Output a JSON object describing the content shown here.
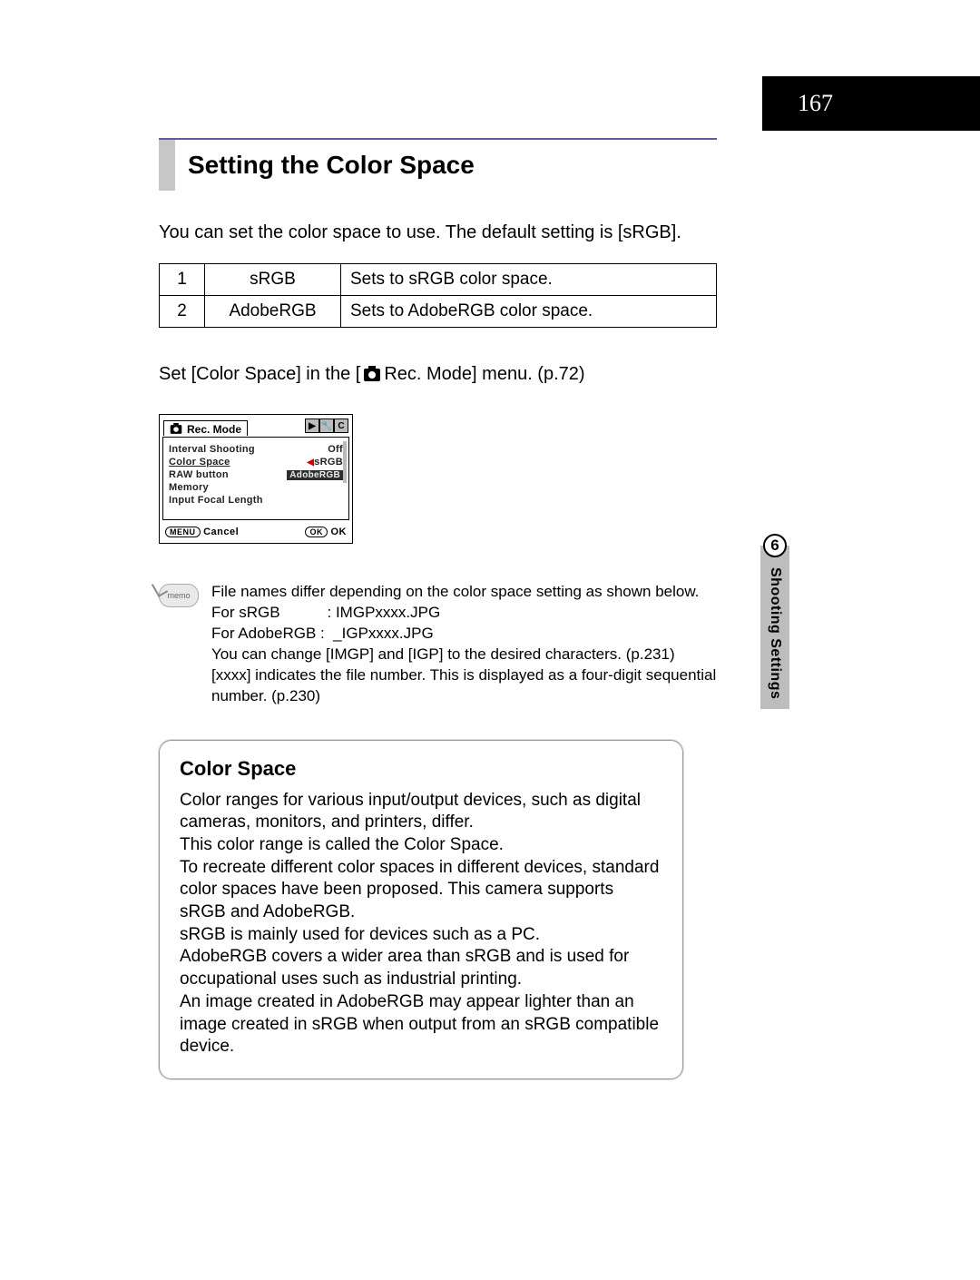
{
  "page_number": "167",
  "side": {
    "chapter_num": "6",
    "chapter_title": "Shooting Settings"
  },
  "heading": "Setting the Color Space",
  "intro": "You can set the color space to use. The default setting is [sRGB].",
  "options": [
    {
      "num": "1",
      "name": "sRGB",
      "desc": "Sets to sRGB color space."
    },
    {
      "num": "2",
      "name": "AdobeRGB",
      "desc": "Sets to AdobeRGB color space."
    }
  ],
  "set_line": {
    "pre": "Set [Color Space] in the [",
    "post": " Rec. Mode] menu. (p.72)"
  },
  "lcd": {
    "tab_label": "Rec. Mode",
    "right_icons": [
      "▶",
      "🔧",
      "C"
    ],
    "rows": [
      {
        "label": "Interval Shooting",
        "value": "Off",
        "selected": false
      },
      {
        "label": "Color Space",
        "value_srgb": "sRGB",
        "value_adobe": "AdobeRGB",
        "selected": true
      },
      {
        "label": "RAW button",
        "value": "",
        "selected": false
      },
      {
        "label": "Memory",
        "value": "",
        "selected": false
      },
      {
        "label": "Input Focal Length",
        "value": "",
        "selected": false
      }
    ],
    "foot_left_btn": "MENU",
    "foot_left": "Cancel",
    "foot_right_btn": "OK",
    "foot_right": "OK"
  },
  "memo": {
    "label": "memo",
    "lines": [
      "File names differ depending on the color space setting as shown below.",
      "For sRGB           : IMGPxxxx.JPG",
      "For AdobeRGB :  _IGPxxxx.JPG",
      "You can change [IMGP] and [IGP] to the desired characters. (p.231)",
      "[xxxx] indicates the file number. This is displayed as a four-digit sequential number. (p.230)"
    ]
  },
  "info": {
    "title": "Color Space",
    "body": "Color ranges for various input/output devices, such as digital cameras, monitors, and printers, differ.\nThis color range is called the Color Space.\nTo recreate different color spaces in different devices, standard color spaces have been proposed. This camera supports sRGB and AdobeRGB.\nsRGB is mainly used for devices such as a PC.\nAdobeRGB covers a wider area than sRGB and is used for occupational uses such as industrial printing.\nAn image created in AdobeRGB may appear lighter than an image created in sRGB when output from an sRGB compatible device."
  }
}
